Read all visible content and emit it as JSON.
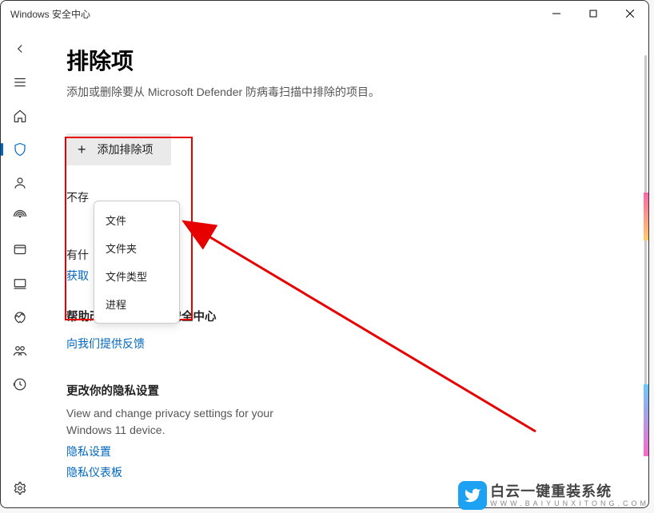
{
  "window": {
    "title": "Windows 安全中心"
  },
  "page": {
    "heading": "排除项",
    "description": "添加或删除要从 Microsoft Defender 防病毒扫描中排除的项目。"
  },
  "add_button": {
    "label": "添加排除项"
  },
  "dropdown": {
    "items": [
      "文件",
      "文件夹",
      "文件类型",
      "进程"
    ]
  },
  "partial_texts": {
    "line1": "不存",
    "line2": "有什",
    "link_help": "获取"
  },
  "sections": {
    "improve": {
      "title": "帮助改进 Windows 安全中心",
      "link": "向我们提供反馈"
    },
    "privacy": {
      "title": "更改你的隐私设置",
      "body": "View and change privacy settings for your Windows 11 device.",
      "link1": "隐私设置",
      "link2": "隐私仪表板"
    }
  },
  "watermark": {
    "cn": "白云一键重装系统",
    "en": "WWW.BAIYUNXITONG.COM"
  }
}
